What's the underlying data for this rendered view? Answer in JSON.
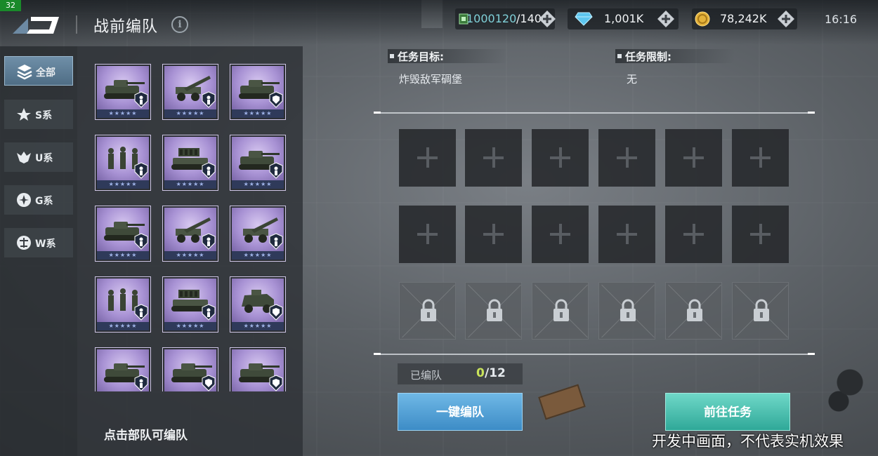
{
  "fps": "32",
  "header": {
    "title": "战前编队",
    "resources": {
      "troops_current": "1000120",
      "troops_max": "/140",
      "gems": "1,001K",
      "gold": "78,242K"
    },
    "clock": "16:16"
  },
  "categories": [
    {
      "label": "全部",
      "icon": "layers-icon",
      "active": true
    },
    {
      "label": "S系",
      "icon": "s-faction-icon",
      "active": false
    },
    {
      "label": "U系",
      "icon": "u-faction-icon",
      "active": false
    },
    {
      "label": "G系",
      "icon": "g-faction-icon",
      "active": false
    },
    {
      "label": "W系",
      "icon": "w-faction-icon",
      "active": false
    }
  ],
  "units": [
    {
      "type": "tank",
      "badge": "infantry-badge-icon"
    },
    {
      "type": "artillery",
      "badge": "infantry-badge-icon"
    },
    {
      "type": "tank",
      "badge": "shield-badge-icon"
    },
    {
      "type": "infantry",
      "badge": "infantry-badge-icon"
    },
    {
      "type": "rocket",
      "badge": "infantry-badge-icon"
    },
    {
      "type": "tank",
      "badge": "infantry-badge-icon"
    },
    {
      "type": "tank",
      "badge": "infantry-badge-icon"
    },
    {
      "type": "artillery",
      "badge": "infantry-badge-icon"
    },
    {
      "type": "artillery",
      "badge": "infantry-badge-icon"
    },
    {
      "type": "infantry",
      "badge": "infantry-badge-icon"
    },
    {
      "type": "rocket",
      "badge": "infantry-badge-icon"
    },
    {
      "type": "armored-car",
      "badge": "shield-badge-icon"
    },
    {
      "type": "tank",
      "badge": "infantry-badge-icon"
    },
    {
      "type": "tank",
      "badge": "shield-badge-icon"
    },
    {
      "type": "tank",
      "badge": "shield-badge-icon"
    }
  ],
  "unit_panel": {
    "hint": "点击部队可编队"
  },
  "mission": {
    "objective_label": "任务目标:",
    "objective_value": "炸毁敌军碉堡",
    "restriction_label": "任务限制:",
    "restriction_value": "无"
  },
  "formation": {
    "count_label": "已编队",
    "count_current": "0",
    "count_max": "/12",
    "slots_open": 12,
    "slots_locked": 6
  },
  "buttons": {
    "auto_form": "一键编队",
    "go_mission": "前往任务"
  },
  "watermark": "开发中画面，不代表实机效果"
}
